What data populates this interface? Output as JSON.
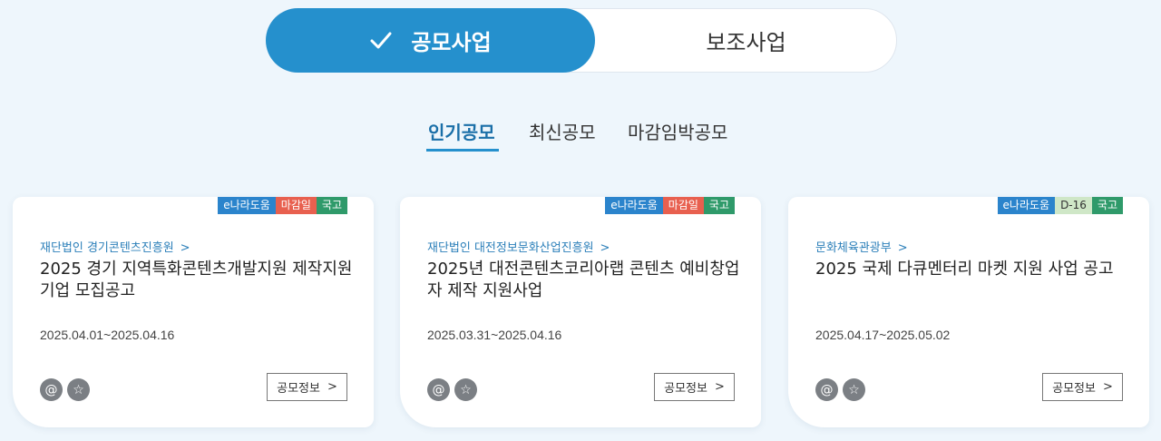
{
  "toggle": {
    "active_label": "공모사업",
    "inactive_label": "보조사업",
    "active_icon": "check-icon",
    "accent": "#2590cd"
  },
  "tabs": [
    {
      "label": "인기공모",
      "active": true
    },
    {
      "label": "최신공모",
      "active": false
    },
    {
      "label": "마감임박공모",
      "active": false
    }
  ],
  "cards": [
    {
      "badges": [
        {
          "label": "e나라도움",
          "color": "#2b84cc"
        },
        {
          "label": "마감일",
          "color": "#e8604f"
        },
        {
          "label": "국고",
          "color": "#2f9a6a"
        }
      ],
      "org": "재단법인 경기콘텐츠진흥원",
      "title": "2025 경기 지역특화콘텐츠개발지원 제작지원 기업 모집공고",
      "date": "2025.04.01~2025.04.16",
      "button": "공모정보"
    },
    {
      "badges": [
        {
          "label": "e나라도움",
          "color": "#2b84cc"
        },
        {
          "label": "마감일",
          "color": "#e8604f"
        },
        {
          "label": "국고",
          "color": "#2f9a6a"
        }
      ],
      "org": "재단법인 대전정보문화산업진흥원",
      "title": "2025년 대전콘텐츠코리아랩 콘텐츠 예비창업자 제작 지원사업",
      "date": "2025.03.31~2025.04.16",
      "button": "공모정보"
    },
    {
      "badges": [
        {
          "label": "e나라도움",
          "color": "#2b84cc"
        },
        {
          "label": "D-16",
          "color": "#cfe7c7"
        },
        {
          "label": "국고",
          "color": "#2f9a6a"
        }
      ],
      "org": "문화체육관광부",
      "title": "2025 국제 다큐멘터리 마켓 지원 사업 공고",
      "date": "2025.04.17~2025.05.02",
      "button": "공모정보"
    }
  ],
  "card_icons": [
    "at-icon",
    "star-icon"
  ]
}
